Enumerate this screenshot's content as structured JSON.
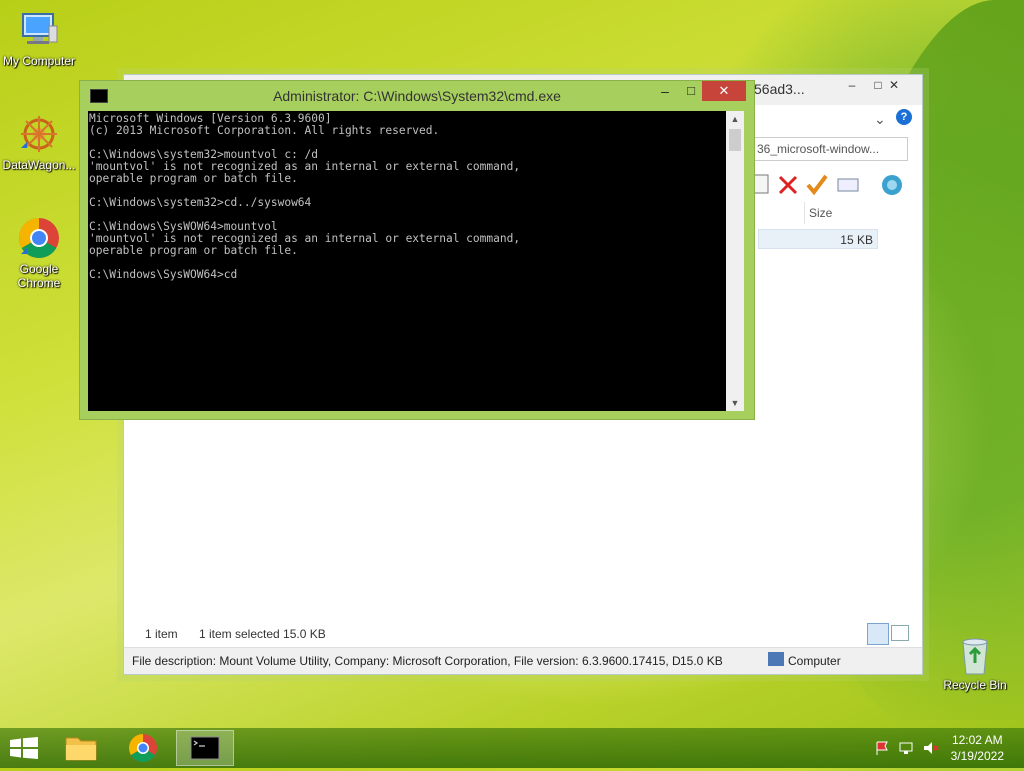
{
  "desktop": {
    "icons": [
      {
        "label": "My Computer"
      },
      {
        "label": "DataWagon..."
      },
      {
        "label": "Google Chrome"
      },
      {
        "label": "Recycle Bin"
      }
    ]
  },
  "explorer": {
    "title_fragment": "56ad3...",
    "address_fragment": "36_microsoft-window...",
    "column_size": "Size",
    "row_size": "15 KB",
    "status": {
      "items": "1 item",
      "selected": "1 item selected  15.0 KB"
    },
    "details": {
      "description": "File description: Mount Volume Utility, Company: Microsoft Corporation, File version: 6.3.9600.17415, D",
      "size": "15.0 KB",
      "location": "Computer"
    }
  },
  "cmd": {
    "title": "Administrator: C:\\Windows\\System32\\cmd.exe",
    "lines": [
      "Microsoft Windows [Version 6.3.9600]",
      "(c) 2013 Microsoft Corporation. All rights reserved.",
      "",
      "C:\\Windows\\system32>mountvol c: /d",
      "'mountvol' is not recognized as an internal or external command,",
      "operable program or batch file.",
      "",
      "C:\\Windows\\system32>cd../syswow64",
      "",
      "C:\\Windows\\SysWOW64>mountvol",
      "'mountvol' is not recognized as an internal or external command,",
      "operable program or batch file.",
      "",
      "C:\\Windows\\SysWOW64>cd"
    ],
    "min_label": "–",
    "max_label": "□",
    "close_label": "✕"
  },
  "explorer_buttons": {
    "min_label": "–",
    "max_label": "□",
    "close_label": "✕",
    "chevron": "⌄",
    "help": "?"
  },
  "taskbar": {
    "time": "12:02 AM",
    "date": "3/19/2022"
  }
}
